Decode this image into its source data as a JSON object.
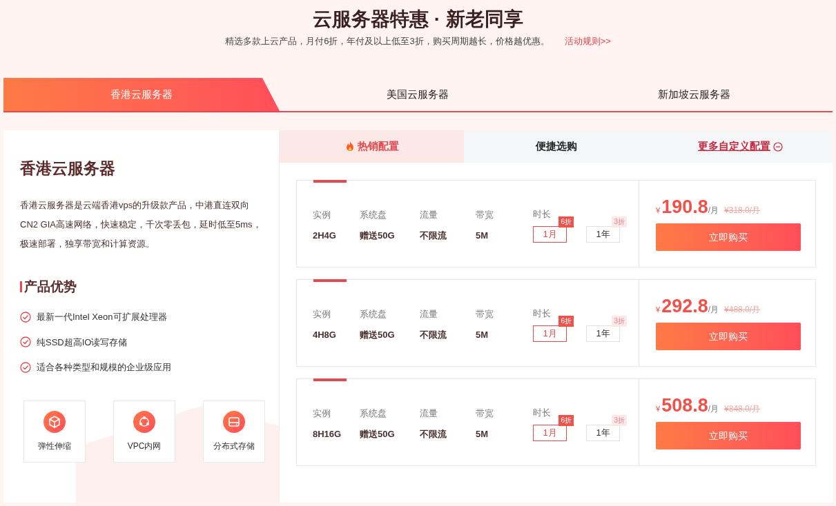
{
  "header": {
    "title": "云服务器特惠 · 新老同享",
    "subtitle": "精选多款上云产品，月付6折，年付及以上低至3折，购买周期越长，价格越优惠。",
    "rules_link": "活动规则>>"
  },
  "region_tabs": [
    {
      "label": "香港云服务器",
      "selected": true
    },
    {
      "label": "美国云服务器",
      "selected": false
    },
    {
      "label": "新加坡云服务器",
      "selected": false
    }
  ],
  "intro": {
    "title": "香港云服务器",
    "description": "香港云服务器是云端香港vps的升级款产品，中港直连双向CN2 GIA高速网络，快速稳定，千次零丢包，延时低至5ms，极速部署，独享带宽和计算资源。",
    "advantages_title": "产品优势",
    "advantages": [
      "最新一代Intel Xeon可扩展处理器",
      "纯SSD超高IO读写存储",
      "适合各种类型和规模的企业级应用"
    ],
    "features": [
      {
        "kind": "cube",
        "label": "弹性伸缩"
      },
      {
        "kind": "network",
        "label": "VPC内网"
      },
      {
        "kind": "disk",
        "label": "分布式存储"
      }
    ]
  },
  "plan_tabs": [
    {
      "kind": "tab",
      "label": "热销配置",
      "selected": true
    },
    {
      "kind": "tab",
      "label": "便捷选购",
      "selected": false
    },
    {
      "kind": "link",
      "label": "更多自定义配置",
      "selected": false
    }
  ],
  "plans": [
    {
      "specs": [
        {
          "label": "实例",
          "value": "2H4G"
        },
        {
          "label": "系统盘",
          "value": "赠送50G"
        },
        {
          "label": "流量",
          "value": "不限流"
        },
        {
          "label": "带宽",
          "value": "5M"
        }
      ],
      "duration_label": "时长",
      "durations": [
        {
          "label": "1月",
          "discount": "6折",
          "selected": true
        },
        {
          "label": "1年",
          "discount": "3折",
          "selected": false
        }
      ],
      "currency": "¥",
      "price": "190.8",
      "unit": "/月",
      "original_price": "¥318.0/月",
      "buy_button": "立即购买"
    },
    {
      "specs": [
        {
          "label": "实例",
          "value": "4H8G"
        },
        {
          "label": "系统盘",
          "value": "赠送50G"
        },
        {
          "label": "流量",
          "value": "不限流"
        },
        {
          "label": "带宽",
          "value": "5M"
        }
      ],
      "duration_label": "时长",
      "durations": [
        {
          "label": "1月",
          "discount": "6折",
          "selected": true
        },
        {
          "label": "1年",
          "discount": "3折",
          "selected": false
        }
      ],
      "currency": "¥",
      "price": "292.8",
      "unit": "/月",
      "original_price": "¥488.0/月",
      "buy_button": "立即购买"
    },
    {
      "specs": [
        {
          "label": "实例",
          "value": "8H16G"
        },
        {
          "label": "系统盘",
          "value": "赠送50G"
        },
        {
          "label": "流量",
          "value": "不限流"
        },
        {
          "label": "带宽",
          "value": "5M"
        }
      ],
      "duration_label": "时长",
      "durations": [
        {
          "label": "1月",
          "discount": "6折",
          "selected": true
        },
        {
          "label": "1年",
          "discount": "3折",
          "selected": false
        }
      ],
      "currency": "¥",
      "price": "508.8",
      "unit": "/月",
      "original_price": "¥848.0/月",
      "buy_button": "立即购买"
    }
  ]
}
